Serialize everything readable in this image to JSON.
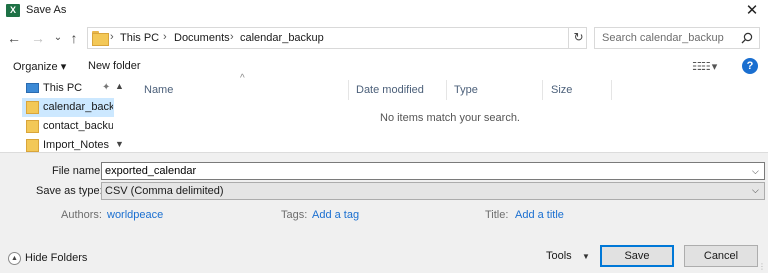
{
  "window": {
    "title": "Save As",
    "app_icon": "excel-icon",
    "close_glyph": "✕"
  },
  "nav": {
    "back_glyph": "←",
    "forward_glyph": "→",
    "recent_glyph": "⌄",
    "up_glyph": "↑",
    "breadcrumb": [
      "This PC",
      "Documents",
      "calendar_backup"
    ],
    "crumb_sep": "›",
    "refresh_glyph": "↻"
  },
  "search": {
    "placeholder": "Search calendar_backup"
  },
  "toolbar": {
    "organize_label": "Organize ▾",
    "new_folder_label": "New folder",
    "help_glyph": "?"
  },
  "sidebar": {
    "items": [
      {
        "label": "This PC",
        "icon": "computer-icon"
      },
      {
        "label": "calendar_backup",
        "icon": "folder-icon",
        "selected": true
      },
      {
        "label": "contact_backup",
        "icon": "folder-icon"
      },
      {
        "label": "Import_Notes",
        "icon": "folder-icon"
      }
    ],
    "pin_glyph": "📌"
  },
  "filelist": {
    "columns": [
      "Name",
      "Date modified",
      "Type",
      "Size"
    ],
    "empty_message": "No items match your search."
  },
  "form": {
    "filename_label": "File name:",
    "filename_value": "exported_calendar",
    "savetype_label": "Save as type:",
    "savetype_value": "CSV (Comma delimited)",
    "authors_label": "Authors:",
    "authors_value": "worldpeace",
    "tags_label": "Tags:",
    "tags_value": "Add a tag",
    "title_label": "Title:",
    "title_value": "Add a title"
  },
  "footer": {
    "hide_folders_label": "Hide Folders",
    "tools_label": "Tools",
    "save_label": "Save",
    "cancel_label": "Cancel"
  },
  "colors": {
    "accent": "#0078d7",
    "link": "#1a6fd0",
    "selected_bg": "#cce8ff",
    "folder": "#f3c857"
  }
}
